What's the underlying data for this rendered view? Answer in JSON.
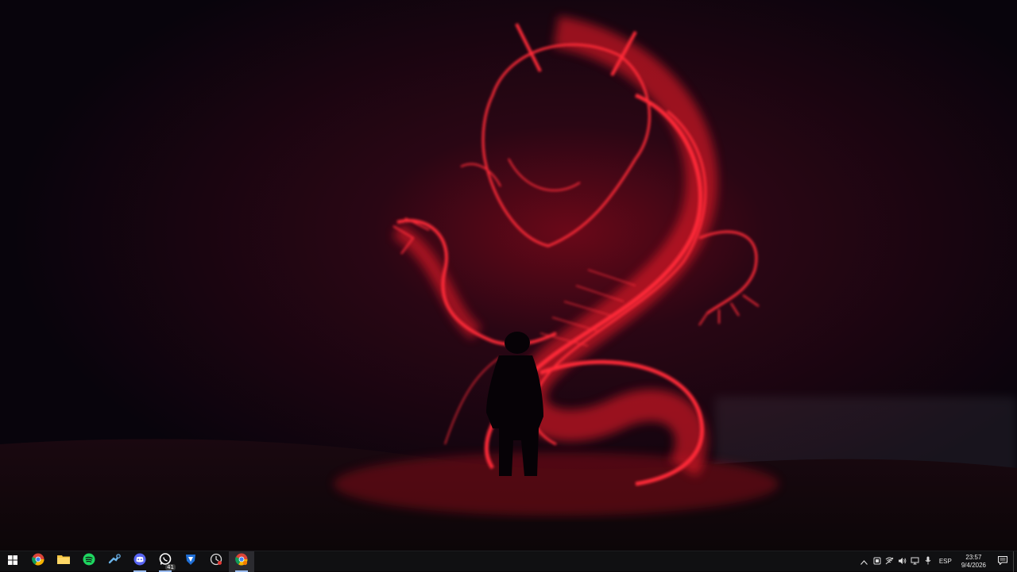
{
  "wallpaper": {
    "subject": "red-dragon-silhouette-wallpaper",
    "colors": {
      "glow": "#ff1a2a",
      "background": "#0b0610",
      "silhouette": "#060206"
    }
  },
  "taskbar": {
    "start_icon": "windows-start-icon",
    "apps": [
      {
        "icon": "chrome-icon",
        "running": false,
        "active": false
      },
      {
        "icon": "file-explorer-icon",
        "running": false,
        "active": false
      },
      {
        "icon": "spotify-icon",
        "running": false,
        "active": false
      },
      {
        "icon": "steam-icon",
        "running": false,
        "active": false
      },
      {
        "icon": "discord-icon",
        "running": true,
        "active": false
      },
      {
        "icon": "whatsapp-icon",
        "running": true,
        "active": false,
        "badge": "41"
      },
      {
        "icon": "rocket-league-icon",
        "running": false,
        "active": false
      },
      {
        "icon": "clock-app-icon",
        "running": false,
        "active": false
      },
      {
        "icon": "chrome-profile-icon",
        "running": true,
        "active": true
      }
    ],
    "tray": {
      "language": "ESP",
      "time": "23:57",
      "date": "9/4/2026"
    },
    "colors": {
      "bar": "#101012",
      "indicator": "#9bbcf0"
    }
  }
}
